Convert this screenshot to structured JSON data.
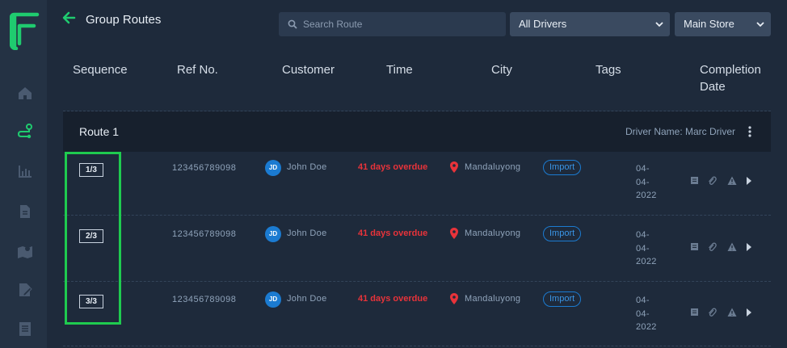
{
  "app": {
    "title": "Group Routes",
    "brand_color": "#1fcb6f"
  },
  "sidebar": {
    "items": [
      {
        "icon": "home-icon",
        "active": false
      },
      {
        "icon": "route-icon",
        "active": true
      },
      {
        "icon": "chart-icon",
        "active": false
      },
      {
        "icon": "document-icon",
        "active": false
      },
      {
        "icon": "map-icon",
        "active": false
      },
      {
        "icon": "edit-document-icon",
        "active": false
      },
      {
        "icon": "list-document-icon",
        "active": false
      }
    ]
  },
  "toolbar": {
    "search_placeholder": "Search Route",
    "driver_filter": "All Drivers",
    "store_filter": "Main Store"
  },
  "table": {
    "headers": {
      "sequence": "Sequence",
      "ref": "Ref No.",
      "customer": "Customer",
      "time": "Time",
      "city": "City",
      "tags": "Tags",
      "completion_line1": "Completion",
      "completion_line2": "Date"
    }
  },
  "route": {
    "title": "Route 1",
    "driver_label": "Driver Name: Marc Driver"
  },
  "rows": [
    {
      "sequence": "1/3",
      "ref": "123456789098",
      "initials": "JD",
      "customer": "John Doe",
      "time": "41 days overdue",
      "city": "Mandaluyong",
      "tag": "Import",
      "date_l1": "04-",
      "date_l2": "04-",
      "date_l3": "2022"
    },
    {
      "sequence": "2/3",
      "ref": "123456789098",
      "initials": "JD",
      "customer": "John Doe",
      "time": "41 days overdue",
      "city": "Mandaluyong",
      "tag": "Import",
      "date_l1": "04-",
      "date_l2": "04-",
      "date_l3": "2022"
    },
    {
      "sequence": "3/3",
      "ref": "123456789098",
      "initials": "JD",
      "customer": "John Doe",
      "time": "41 days overdue",
      "city": "Mandaluyong",
      "tag": "Import",
      "date_l1": "04-",
      "date_l2": "04-",
      "date_l3": "2022"
    }
  ],
  "colors": {
    "overdue": "#e8333a",
    "tag": "#1b7bd1",
    "highlight": "#1fcb4f"
  }
}
